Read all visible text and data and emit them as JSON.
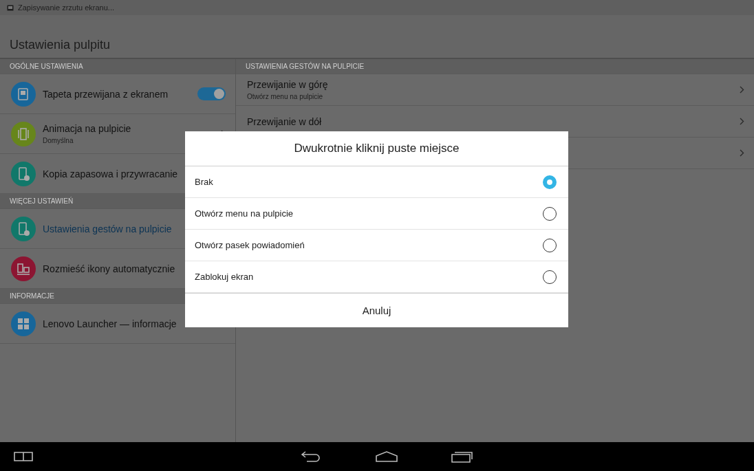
{
  "status_bar": {
    "notification": "Zapisywanie zrzutu ekranu..."
  },
  "title": "Ustawienia pulpitu",
  "left_sections": [
    {
      "header": "OGÓLNE USTAWIENIA",
      "items": [
        {
          "title": "Tapeta przewijana z ekranem",
          "color": "#17669a",
          "kind": "toggle",
          "on": true,
          "selected": false
        },
        {
          "title": "Animacja na pulpicie",
          "subtitle": "Domyślna",
          "color": "#67861b",
          "kind": "link",
          "selected": false
        },
        {
          "title": "Kopia zapasowa i przywracanie",
          "color": "#11786a",
          "kind": "plain",
          "selected": false
        }
      ]
    },
    {
      "header": "WIĘCEJ USTAWIEŃ",
      "items": [
        {
          "title": "Ustawienia gestów na pulpicie",
          "color": "#11786a",
          "kind": "plain",
          "selected": true
        },
        {
          "title": "Rozmieść ikony automatycznie",
          "color": "#8c1532",
          "kind": "plain",
          "selected": false
        }
      ]
    },
    {
      "header": "INFORMACJE",
      "items": [
        {
          "title": "Lenovo Launcher — informacje",
          "color": "#17669a",
          "kind": "plain",
          "selected": false
        }
      ]
    }
  ],
  "right_panel": {
    "header": "USTAWIENIA GESTÓW NA PULPICIE",
    "rows": [
      {
        "kind": "setting",
        "title": "Przewijanie w górę",
        "subtitle": "Otwórz menu na pulpicie"
      },
      {
        "kind": "setting",
        "title": "Przewijanie w dół"
      },
      {
        "kind": "covered"
      }
    ]
  },
  "dialog": {
    "title": "Dwukrotnie kliknij puste miejsce",
    "options": [
      {
        "label": "Brak",
        "selected": true
      },
      {
        "label": "Otwórz menu na pulpicie",
        "selected": false
      },
      {
        "label": "Otwórz pasek powiadomień",
        "selected": false
      },
      {
        "label": "Zablokuj ekran",
        "selected": false
      }
    ],
    "cancel": "Anuluj"
  }
}
